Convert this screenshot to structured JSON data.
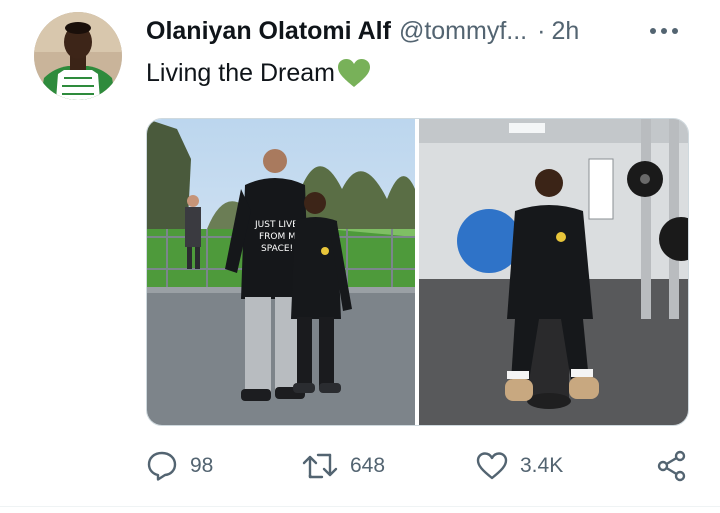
{
  "tweet": {
    "author_name": "Olaniyan Olatomi Alf",
    "author_handle": "@tommyf...",
    "separator": "·",
    "time_ago": "2h",
    "text": "Living the Dream",
    "emoji_icon": "green-heart-icon"
  },
  "media": {
    "left_photo_shirt_text": "JUST LIVE FROM MAD SPACE!"
  },
  "actions": {
    "replies": "98",
    "retweets": "648",
    "likes": "3.4K"
  },
  "colors": {
    "text_primary": "#0f1419",
    "text_secondary": "#536471",
    "border": "#cfd9de",
    "heart_green": "#78b159"
  }
}
